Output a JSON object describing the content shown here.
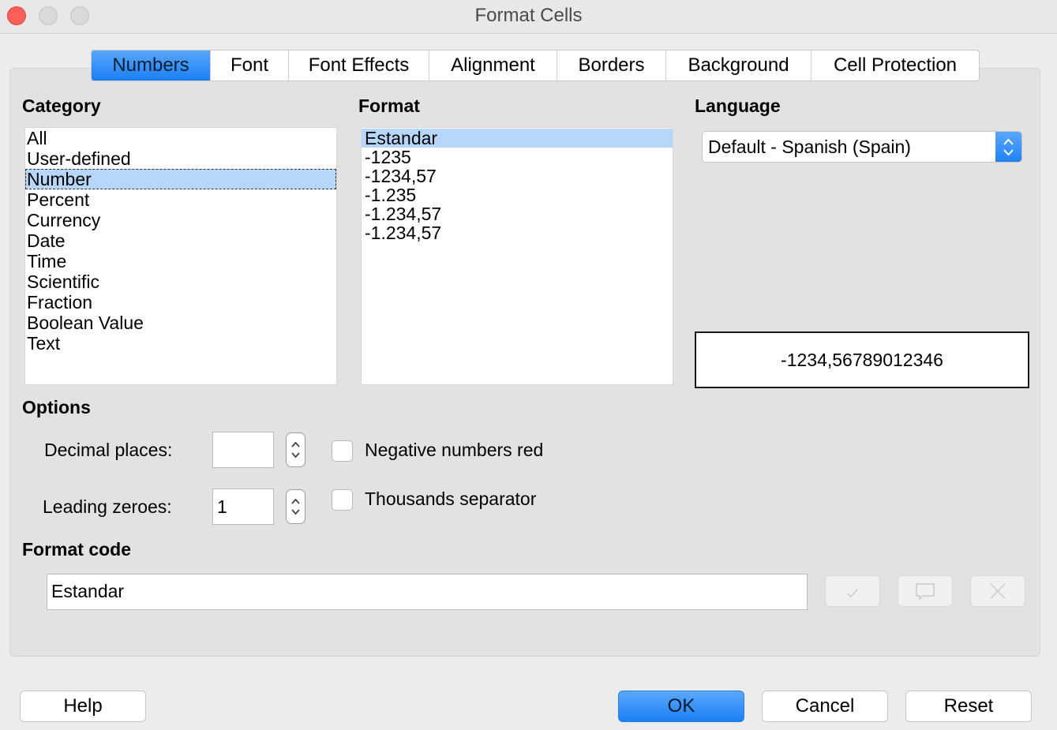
{
  "window": {
    "title": "Format Cells"
  },
  "tabs": [
    {
      "label": "Numbers",
      "active": true
    },
    {
      "label": "Font"
    },
    {
      "label": "Font Effects"
    },
    {
      "label": "Alignment"
    },
    {
      "label": "Borders"
    },
    {
      "label": "Background"
    },
    {
      "label": "Cell Protection"
    }
  ],
  "category": {
    "heading": "Category",
    "items": [
      "All",
      "User-defined",
      "Number",
      "Percent",
      "Currency",
      "Date",
      "Time",
      "Scientific",
      "Fraction",
      "Boolean Value",
      "Text"
    ],
    "selected": "Number"
  },
  "format": {
    "heading": "Format",
    "items": [
      "Estandar",
      "-1235",
      "-1234,57",
      "-1.235",
      "-1.234,57",
      "-1.234,57"
    ],
    "selected": "Estandar"
  },
  "language": {
    "heading": "Language",
    "selected_value": "Default - Spanish (Spain)"
  },
  "preview": {
    "value": "-1234,56789012346"
  },
  "options": {
    "heading": "Options",
    "decimal_places_label": "Decimal places:",
    "decimal_places_value": "",
    "leading_zeroes_label": "Leading zeroes:",
    "leading_zeroes_value": "1",
    "negative_red_label": "Negative numbers red",
    "negative_red_checked": false,
    "thousands_sep_label": "Thousands separator",
    "thousands_sep_checked": false
  },
  "format_code": {
    "heading": "Format code",
    "value": "Estandar"
  },
  "buttons": {
    "help": "Help",
    "ok": "OK",
    "cancel": "Cancel",
    "reset": "Reset"
  },
  "colors": {
    "accent": "#1a7ff5",
    "selection": "#b6d6fa",
    "close": "#fc5f57"
  }
}
